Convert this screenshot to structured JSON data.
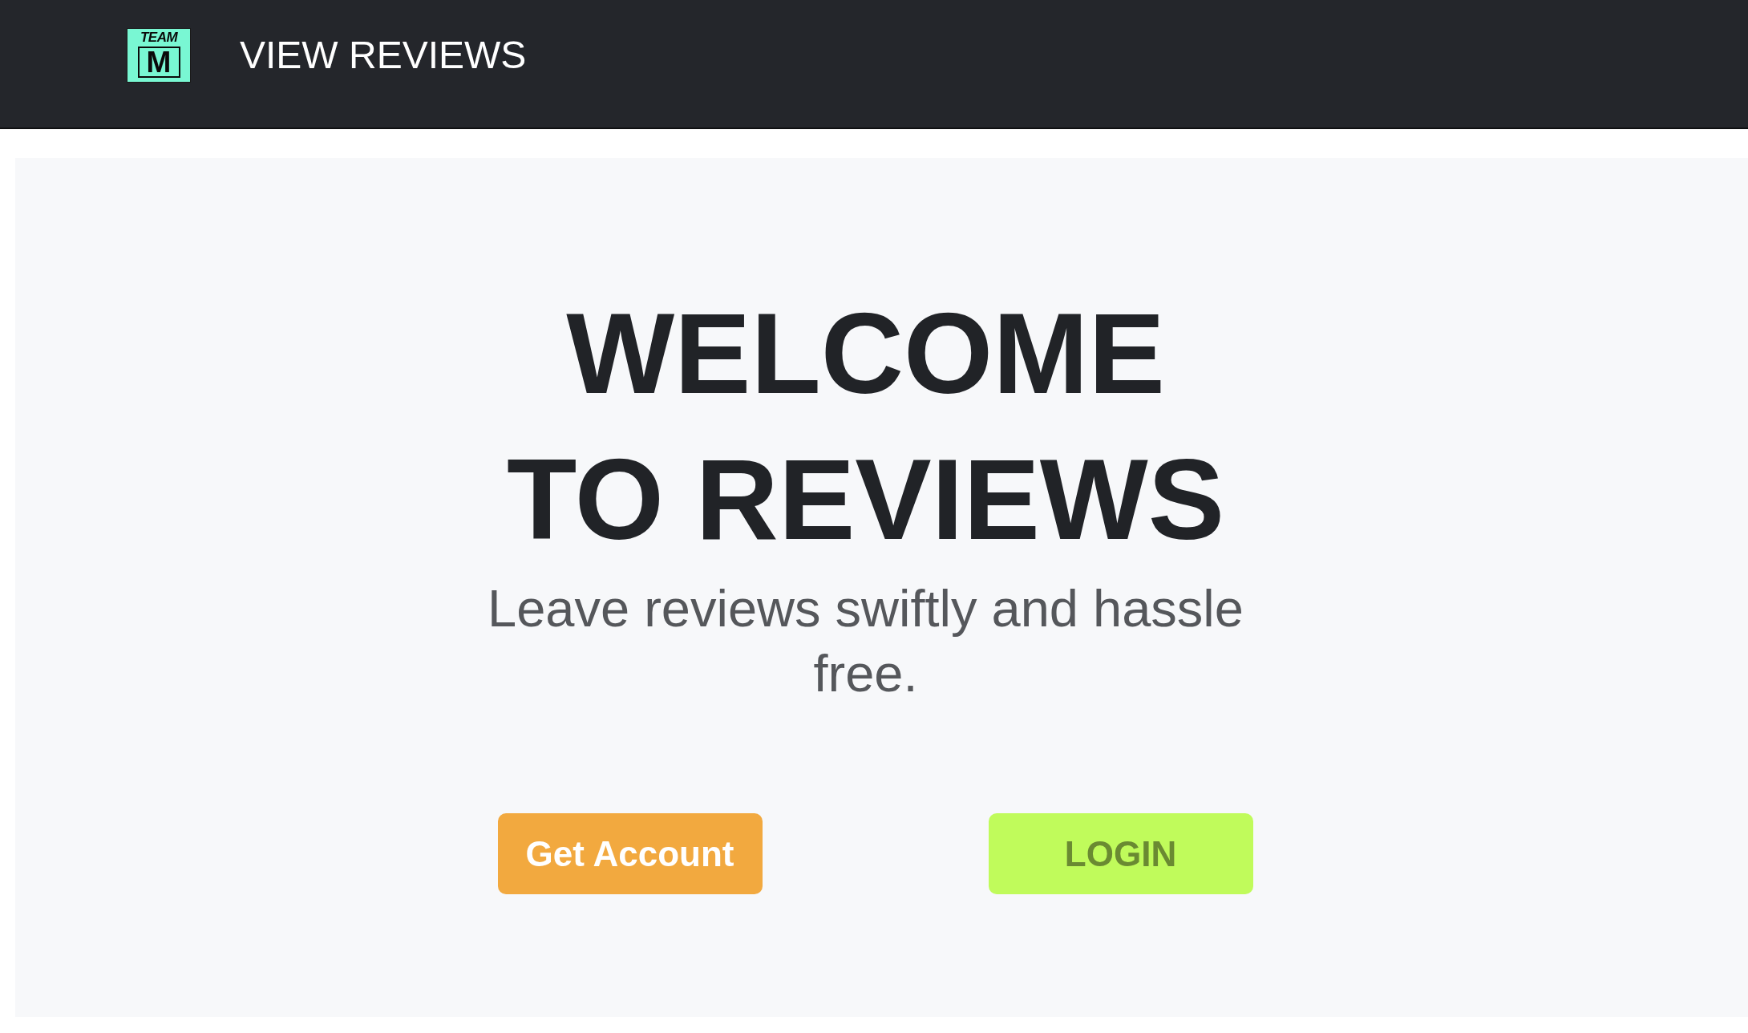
{
  "header": {
    "logo": {
      "top_text": "TEAM",
      "letter": "M"
    },
    "title": "VIEW REVIEWS"
  },
  "hero": {
    "heading": "WELCOME TO REVIEWS",
    "subtitle": "Leave reviews swiftly and hassle free.",
    "buttons": [
      {
        "label": "Get Account",
        "color": "#f2a93f"
      },
      {
        "label": "LOGIN",
        "color": "#c0fb5b"
      }
    ]
  }
}
